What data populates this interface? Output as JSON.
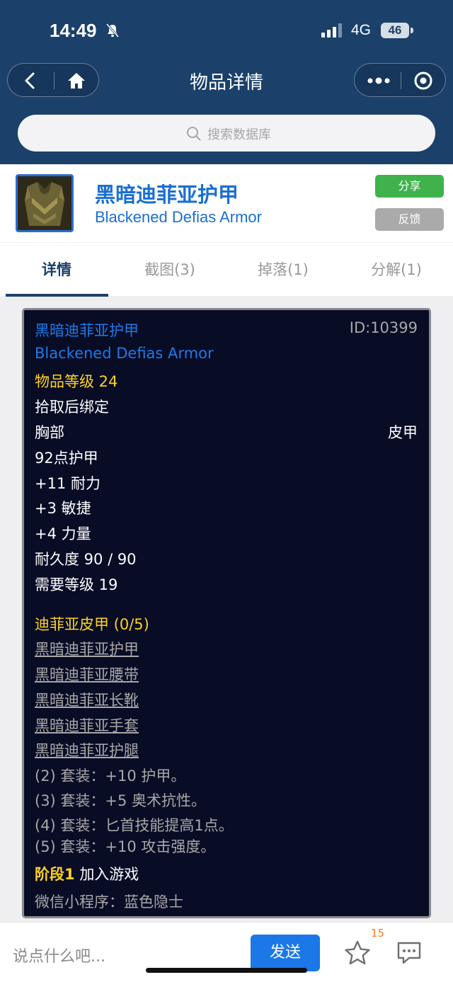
{
  "status_bar": {
    "time": "14:49",
    "network": "4G",
    "battery": "46"
  },
  "nav": {
    "title": "物品详情"
  },
  "search": {
    "placeholder": "搜索数据库"
  },
  "item": {
    "name_cn": "黑暗迪菲亚护甲",
    "name_en": "Blackened Defias Armor",
    "share_label": "分享",
    "feedback_label": "反馈"
  },
  "tabs": [
    {
      "label": "详情"
    },
    {
      "label": "截图(3)"
    },
    {
      "label": "掉落(1)"
    },
    {
      "label": "分解(1)"
    }
  ],
  "tooltip": {
    "name_cn": "黑暗迪菲亚护甲",
    "id": "ID:10399",
    "name_en": "Blackened Defias Armor",
    "item_level": "物品等级 24",
    "bind": "拾取后绑定",
    "slot": "胸部",
    "armor_type": "皮甲",
    "armor": "92点护甲",
    "stats": [
      "+11 耐力",
      "+3 敏捷",
      "+4 力量"
    ],
    "durability": "耐久度 90 / 90",
    "required_level": "需要等级 19",
    "set_name": "迪菲亚皮甲 (0/5)",
    "set_items": [
      "黑暗迪菲亚护甲",
      "黑暗迪菲亚腰带",
      "黑暗迪菲亚长靴",
      "黑暗迪菲亚手套",
      "黑暗迪菲亚护腿"
    ],
    "set_bonuses": [
      "(2) 套装：+10 护甲。",
      "(3) 套装：+5 奥术抗性。",
      "(4) 套装：匕首技能提高1点。",
      "(5) 套装：+10 攻击强度。"
    ],
    "phase_label": "阶段1",
    "phase_text": "加入游戏",
    "footer": "微信小程序：蓝色隐士"
  },
  "bottom_bar": {
    "comment_placeholder": "说点什么吧...",
    "send_label": "发送",
    "star_count": "15"
  },
  "colors": {
    "nav_bg": "#1b416b",
    "card_bg": "#080c25",
    "item_blue": "#1e7ae8",
    "gold": "#ffd21f",
    "share_green": "#3fb24c",
    "send_blue": "#1b78e6"
  },
  "icons": [
    "bell-muted-icon",
    "signal-icon",
    "back-icon",
    "home-icon",
    "more-icon",
    "target-icon",
    "search-icon",
    "armor-item-icon",
    "star-icon",
    "message-icon"
  ]
}
